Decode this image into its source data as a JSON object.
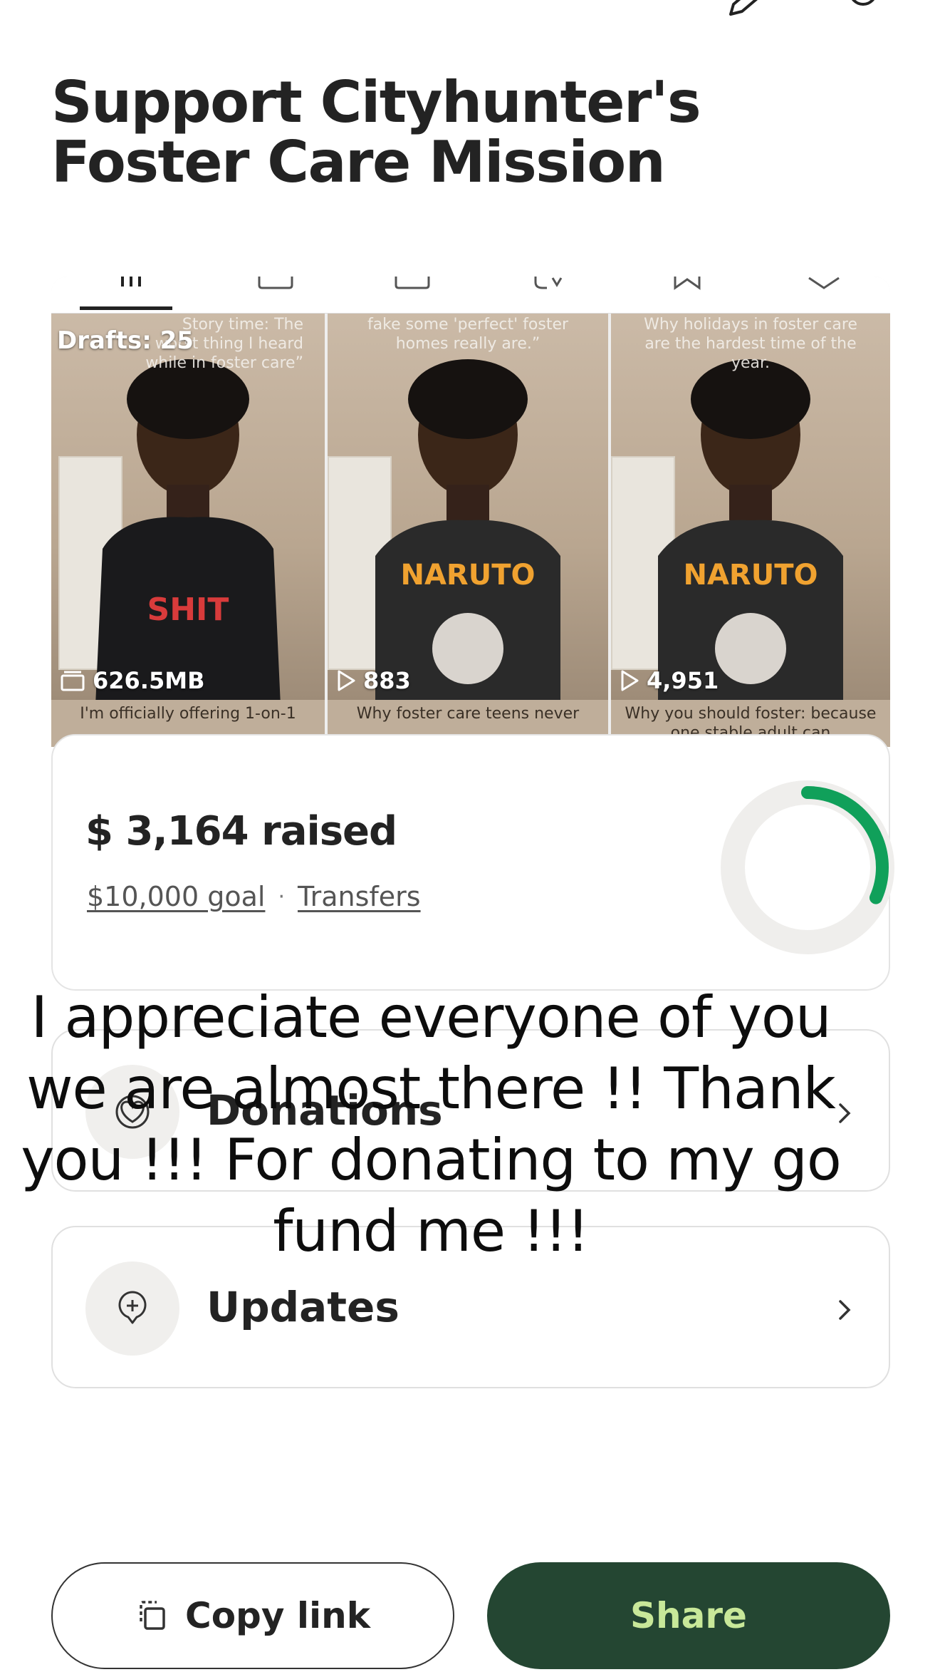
{
  "page": {
    "title": "Support Cityhunter's Foster Care Mission"
  },
  "videos": {
    "drafts_label": "Drafts: 25",
    "items": [
      {
        "caption_top": "Story time: The worst thing I heard while in foster care”",
        "stat_icon": "folder-icon",
        "stat": "626.5MB",
        "caption_bottom": "I'm officially offering 1-on-1"
      },
      {
        "caption_top": "fake some 'perfect' foster homes really are.”",
        "stat_icon": "play-icon",
        "stat": "883",
        "caption_bottom": "Why foster care teens never"
      },
      {
        "caption_top": "Why holidays in foster care are the hardest time of the year.",
        "stat_icon": "play-icon",
        "stat": "4,951",
        "caption_bottom": "Why you should foster: because one stable adult can"
      }
    ]
  },
  "fundraiser": {
    "raised": "$ 3,164 raised",
    "goal": "$10,000 goal",
    "separator": "·",
    "transfers": "Transfers",
    "progress_fraction": 0.3164,
    "ring_color": "#10a05a",
    "ring_track_color": "#efeeec"
  },
  "rows": {
    "donations": {
      "label": "Donations",
      "icon": "heart-hand-icon"
    },
    "updates": {
      "label": "Updates",
      "icon": "plus-pin-icon"
    }
  },
  "overlay": {
    "line1": "I appreciate everyone of you",
    "line2": "we are almost there !! Thank",
    "line3": "you !!! For donating to my go",
    "line4": "fund me !!!"
  },
  "actions": {
    "copy_link": "Copy link",
    "share": "Share",
    "share_bg": "#244632",
    "share_text_color": "#c8e899"
  }
}
